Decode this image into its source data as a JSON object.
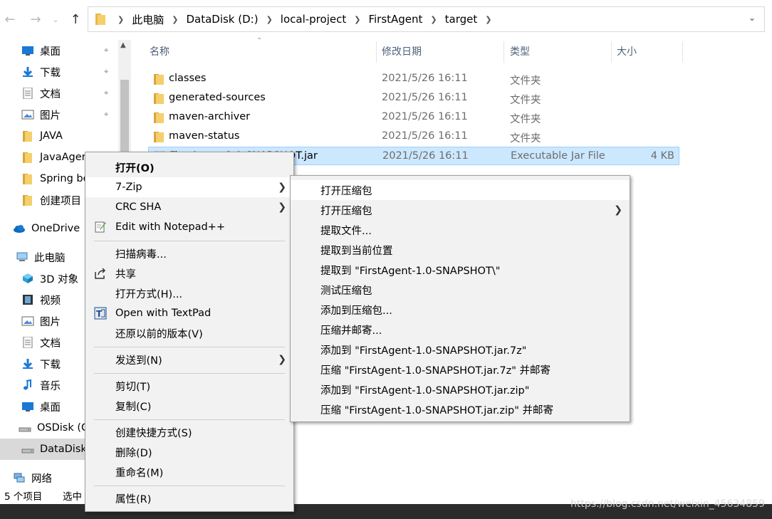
{
  "address": {
    "crumbs": [
      "此电脑",
      "DataDisk (D:)",
      "local-project",
      "FirstAgent",
      "target"
    ]
  },
  "nav": {
    "items": [
      {
        "label": "桌面",
        "icon": "desktop-icon",
        "pinned": true
      },
      {
        "label": "下载",
        "icon": "download-icon",
        "pinned": true
      },
      {
        "label": "文档",
        "icon": "document-icon",
        "pinned": true
      },
      {
        "label": "图片",
        "icon": "picture-icon",
        "pinned": true
      },
      {
        "label": "JAVA",
        "icon": "folder-icon"
      },
      {
        "label": "JavaAgent",
        "icon": "folder-icon"
      },
      {
        "label": "Spring boot",
        "icon": "folder-icon"
      },
      {
        "label": "创建项目",
        "icon": "folder-icon"
      },
      {
        "label": "OneDrive",
        "icon": "cloud-icon"
      },
      {
        "label": "此电脑",
        "icon": "computer-icon"
      },
      {
        "label": "3D 对象",
        "icon": "3d-objects-icon"
      },
      {
        "label": "视频",
        "icon": "video-icon"
      },
      {
        "label": "图片",
        "icon": "picture-icon"
      },
      {
        "label": "文档",
        "icon": "document-icon"
      },
      {
        "label": "下载",
        "icon": "download-icon"
      },
      {
        "label": "音乐",
        "icon": "music-icon"
      },
      {
        "label": "桌面",
        "icon": "desktop-icon"
      },
      {
        "label": "OSDisk (C:)",
        "icon": "drive-icon"
      },
      {
        "label": "DataDisk (D:)",
        "icon": "drive-icon",
        "selected": true
      },
      {
        "label": "网络",
        "icon": "network-icon"
      }
    ]
  },
  "columns": [
    "名称",
    "修改日期",
    "类型",
    "大小"
  ],
  "files": [
    {
      "name": "classes",
      "date": "2021/5/26 16:11",
      "type": "文件夹",
      "size": ""
    },
    {
      "name": "generated-sources",
      "date": "2021/5/26 16:11",
      "type": "文件夹",
      "size": ""
    },
    {
      "name": "maven-archiver",
      "date": "2021/5/26 16:11",
      "type": "文件夹",
      "size": ""
    },
    {
      "name": "maven-status",
      "date": "2021/5/26 16:11",
      "type": "文件夹",
      "size": ""
    },
    {
      "name": "FirstAgent-1.0-SNAPSHOT.jar",
      "date": "2021/5/26 16:11",
      "type": "Executable Jar File",
      "size": "4 KB"
    }
  ],
  "status": {
    "count": "5 个项目",
    "selected": "选中"
  },
  "context_menu": {
    "items": [
      {
        "label": "打开(O)",
        "bold": true
      },
      {
        "label": "7-Zip",
        "submenu": true,
        "highlighted": true
      },
      {
        "label": "CRC SHA",
        "submenu": true
      },
      {
        "label": "Edit with Notepad++",
        "icon": "notepad-plus-icon"
      },
      {
        "label": "扫描病毒..."
      },
      {
        "label": "共享",
        "icon": "share-icon"
      },
      {
        "label": "打开方式(H)..."
      },
      {
        "label": "Open with TextPad",
        "icon": "textpad-icon"
      },
      {
        "label": "还原以前的版本(V)"
      },
      {
        "label": "发送到(N)",
        "submenu": true
      },
      {
        "label": "剪切(T)"
      },
      {
        "label": "复制(C)"
      },
      {
        "label": "创建快捷方式(S)"
      },
      {
        "label": "删除(D)"
      },
      {
        "label": "重命名(M)"
      },
      {
        "label": "属性(R)"
      }
    ]
  },
  "submenu": {
    "items": [
      {
        "label": "打开压缩包",
        "highlighted": true
      },
      {
        "label": "打开压缩包",
        "submenu": true
      },
      {
        "label": "提取文件..."
      },
      {
        "label": "提取到当前位置"
      },
      {
        "label": "提取到 \"FirstAgent-1.0-SNAPSHOT\\\""
      },
      {
        "label": "测试压缩包"
      },
      {
        "label": "添加到压缩包..."
      },
      {
        "label": "压缩并邮寄..."
      },
      {
        "label": "添加到 \"FirstAgent-1.0-SNAPSHOT.jar.7z\""
      },
      {
        "label": "压缩 \"FirstAgent-1.0-SNAPSHOT.jar.7z\" 并邮寄"
      },
      {
        "label": "添加到 \"FirstAgent-1.0-SNAPSHOT.jar.zip\""
      },
      {
        "label": "压缩 \"FirstAgent-1.0-SNAPSHOT.jar.zip\" 并邮寄"
      }
    ]
  },
  "watermark": "https://blog.csdn.net/weixin_45634859",
  "colors": {
    "selection": "#cce8ff",
    "selection_border": "#99d1ff",
    "menu_bg": "#f2f2f2",
    "folder": "#e8b64a"
  }
}
